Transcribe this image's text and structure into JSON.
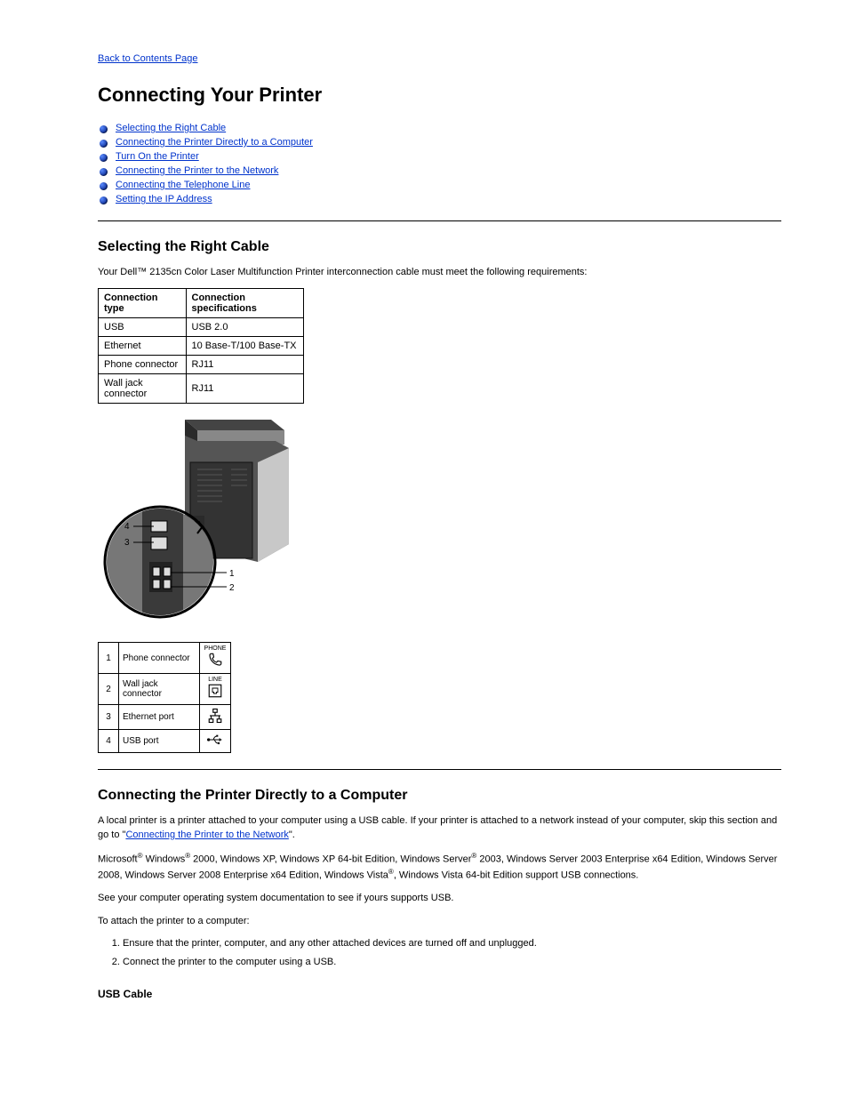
{
  "back_link": "Back to Contents Page",
  "title": "Connecting Your Printer",
  "toc": [
    "Selecting the Right Cable",
    "Connecting the Printer Directly to a Computer",
    "Turn On the Printer",
    "Connecting the Printer to the Network",
    "Connecting the Telephone Line",
    "Setting the IP Address"
  ],
  "sec1": {
    "heading": "Selecting the Right Cable",
    "intro": "Your Dell™ 2135cn Color Laser Multifunction Printer interconnection cable must meet the following requirements:",
    "table_headers": {
      "type": "Connection type",
      "spec": "Connection specifications"
    },
    "rows": [
      {
        "type": "USB",
        "spec": "USB 2.0"
      },
      {
        "type": "Ethernet",
        "spec": "10 Base-T/100 Base-TX"
      },
      {
        "type": "Phone connector",
        "spec": "RJ11"
      },
      {
        "type": "Wall jack connector",
        "spec": "RJ11"
      }
    ],
    "ports": [
      {
        "n": "1",
        "label": "Phone connector"
      },
      {
        "n": "2",
        "label": "Wall jack connector"
      },
      {
        "n": "3",
        "label": "Ethernet port"
      },
      {
        "n": "4",
        "label": "USB port"
      }
    ]
  },
  "sec2": {
    "heading": "Connecting the Printer Directly to a Computer",
    "p1_a": "A local printer is a printer attached to your computer using a USB cable. If your printer is attached to a network instead of your computer, skip this section and go to \"",
    "p1_link": "Connecting the Printer to the Network",
    "p1_b": "\".",
    "p2_a": "Microsoft",
    "p2_b": " Windows",
    "p2_c": " 2000, Windows XP, Windows XP 64-bit Edition, Windows Server",
    "p2_d": " 2003, Windows Server 2003 Enterprise x64 Edition, Windows Server 2008, Windows Server 2008 Enterprise x64 Edition, Windows Vista",
    "p2_e": ", Windows Vista 64-bit Edition support USB connections.",
    "p3": "See your computer operating system documentation to see if yours supports USB.",
    "p4": "To attach the printer to a computer:",
    "li1": "Ensure that the printer, computer, and any other attached devices are turned off and unplugged.",
    "li2": "Connect the printer to the computer using a USB."
  },
  "sub_heading": "USB Cable"
}
